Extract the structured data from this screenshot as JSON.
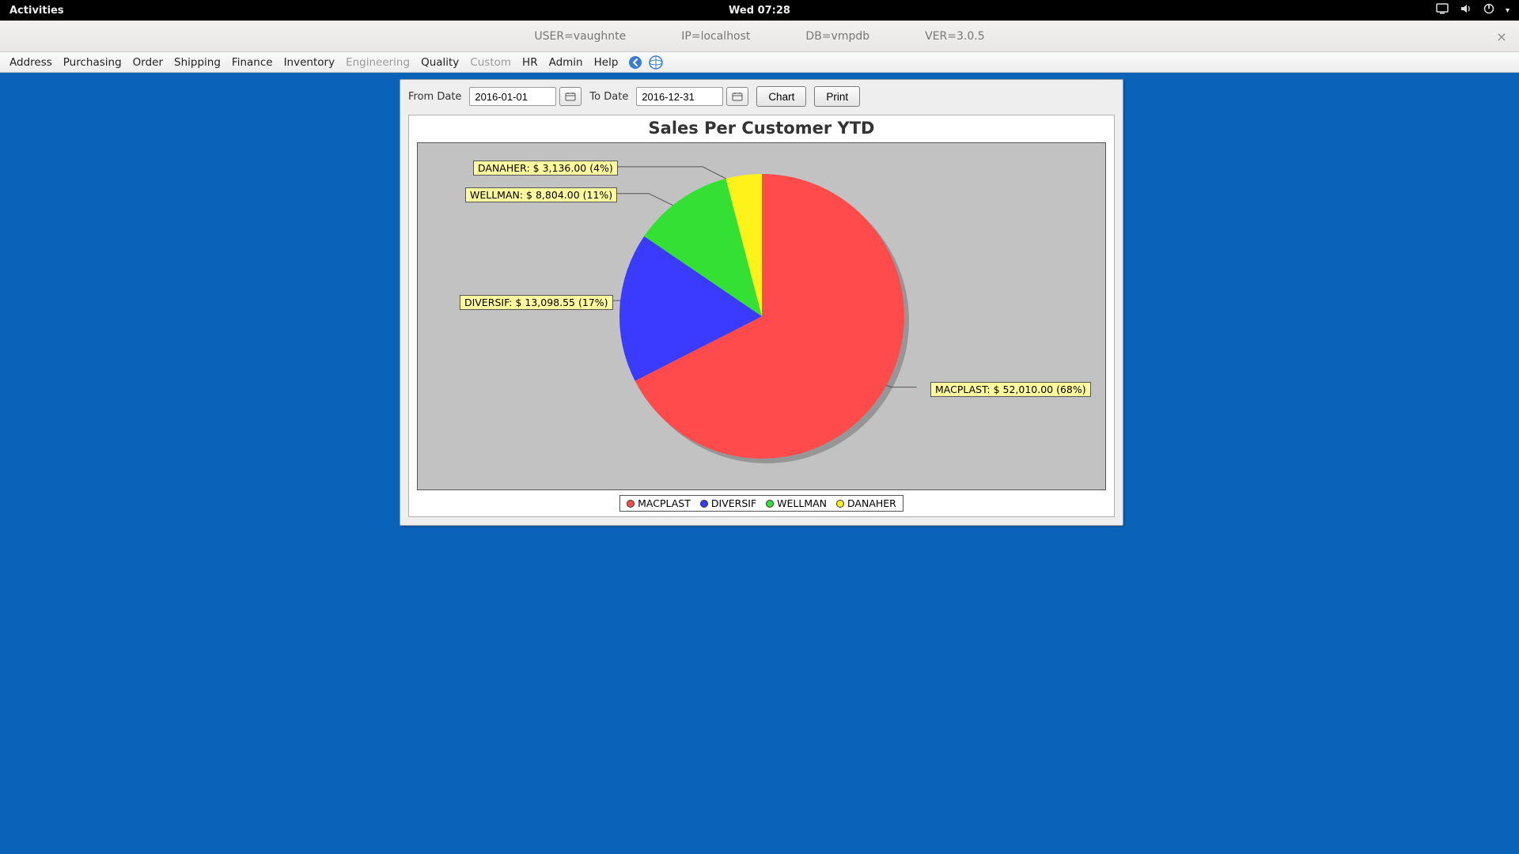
{
  "gnome": {
    "activities": "Activities",
    "clock": "Wed 07:28"
  },
  "titlebar": {
    "user": "USER=vaughnte",
    "ip": "IP=localhost",
    "db": "DB=vmpdb",
    "ver": "VER=3.0.5"
  },
  "menu": {
    "items": [
      "Address",
      "Purchasing",
      "Order",
      "Shipping",
      "Finance",
      "Inventory",
      "Engineering",
      "Quality",
      "Custom",
      "HR",
      "Admin",
      "Help"
    ],
    "disabled": [
      "Engineering",
      "Custom"
    ]
  },
  "controls": {
    "from_label": "From Date",
    "from_value": "2016-01-01",
    "to_label": "To Date",
    "to_value": "2016-12-31",
    "chart_btn": "Chart",
    "print_btn": "Print"
  },
  "chart_data": {
    "type": "pie",
    "title": "Sales Per Customer YTD",
    "series": [
      {
        "name": "MACPLAST",
        "value": 52010.0,
        "percent": 68,
        "color": "#ff4b4b",
        "label": "MACPLAST: $ 52,010.00 (68%)"
      },
      {
        "name": "DIVERSIF",
        "value": 13098.55,
        "percent": 17,
        "color": "#3b3bff",
        "label": "DIVERSIF: $ 13,098.55 (17%)"
      },
      {
        "name": "WELLMAN",
        "value": 8804.0,
        "percent": 11,
        "color": "#33e033",
        "label": "WELLMAN: $ 8,804.00 (11%)"
      },
      {
        "name": "DANAHER",
        "value": 3136.0,
        "percent": 4,
        "color": "#fff21a",
        "label": "DANAHER: $ 3,136.00 (4%)"
      }
    ],
    "legend": [
      "MACPLAST",
      "DIVERSIF",
      "WELLMAN",
      "DANAHER"
    ]
  }
}
